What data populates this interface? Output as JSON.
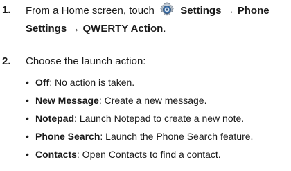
{
  "steps": [
    {
      "number": "1.",
      "intro": "From a Home screen, touch",
      "icon": "settings-gear-icon",
      "path": "Settings → Phone Settings → QWERTY Action",
      "end": "."
    },
    {
      "number": "2.",
      "text": "Choose the launch action:"
    }
  ],
  "options": [
    {
      "name": "Off",
      "desc": ": No action is taken."
    },
    {
      "name": "New Message",
      "desc": ": Create a new message."
    },
    {
      "name": "Notepad",
      "desc": ": Launch Notepad to create a new note."
    },
    {
      "name": "Phone Search",
      "desc": ": Launch the Phone Search feature."
    },
    {
      "name": "Contacts",
      "desc": ": Open Contacts to find a contact."
    }
  ],
  "bullet_glyph": "•"
}
